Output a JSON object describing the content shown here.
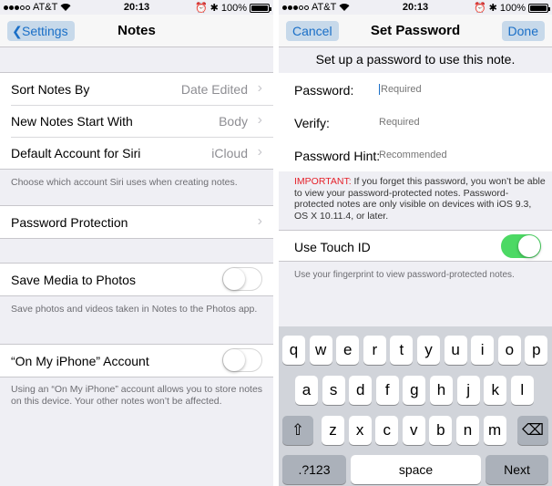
{
  "status": {
    "carrier": "AT&T",
    "time": "20:13",
    "battery": "100%",
    "battery_level": 1.0
  },
  "left": {
    "nav": {
      "back": "Settings",
      "title": "Notes"
    },
    "group1": [
      {
        "label": "Sort Notes By",
        "value": "Date Edited"
      },
      {
        "label": "New Notes Start With",
        "value": "Body"
      },
      {
        "label": "Default Account for Siri",
        "value": "iCloud"
      }
    ],
    "siri_note": "Choose which account Siri uses when creating notes.",
    "password_protection": "Password Protection",
    "save_media": {
      "label": "Save Media to Photos",
      "on": false
    },
    "save_media_note": "Save photos and videos taken in Notes to the Photos app.",
    "on_my_iphone": {
      "label": "“On My iPhone” Account",
      "on": false
    },
    "on_my_iphone_note": "Using an “On My iPhone” account allows you to store notes on this device. Your other notes won’t be affected."
  },
  "right": {
    "nav": {
      "cancel": "Cancel",
      "title": "Set Password",
      "done": "Done"
    },
    "prompt": "Set up a password to use this note.",
    "fields": [
      {
        "label": "Password:",
        "placeholder": "Required"
      },
      {
        "label": "Verify:",
        "placeholder": "Required"
      },
      {
        "label": "Password Hint:",
        "placeholder": "Recommended"
      }
    ],
    "warning_important": "IMPORTANT:",
    "warning_text": " If you forget this password, you won’t be able to view your password-protected notes. Password-protected notes are only visible on devices with iOS 9.3, OS X 10.11.4, or later.",
    "touch_id": {
      "label": "Use Touch ID",
      "on": true
    },
    "touch_note": "Use your fingerprint to view password-protected notes.",
    "keyboard": {
      "row1": [
        "q",
        "w",
        "e",
        "r",
        "t",
        "y",
        "u",
        "i",
        "o",
        "p"
      ],
      "row2": [
        "a",
        "s",
        "d",
        "f",
        "g",
        "h",
        "j",
        "k",
        "l"
      ],
      "row3": [
        "z",
        "x",
        "c",
        "v",
        "b",
        "n",
        "m"
      ],
      "shift": "⇧",
      "delete": "⌫",
      "numbers": ".?123",
      "space": "space",
      "next": "Next"
    }
  },
  "colors": {
    "accent": "#1a6fc7",
    "toggle_on": "#4cd964",
    "warning": "#e5212a"
  }
}
